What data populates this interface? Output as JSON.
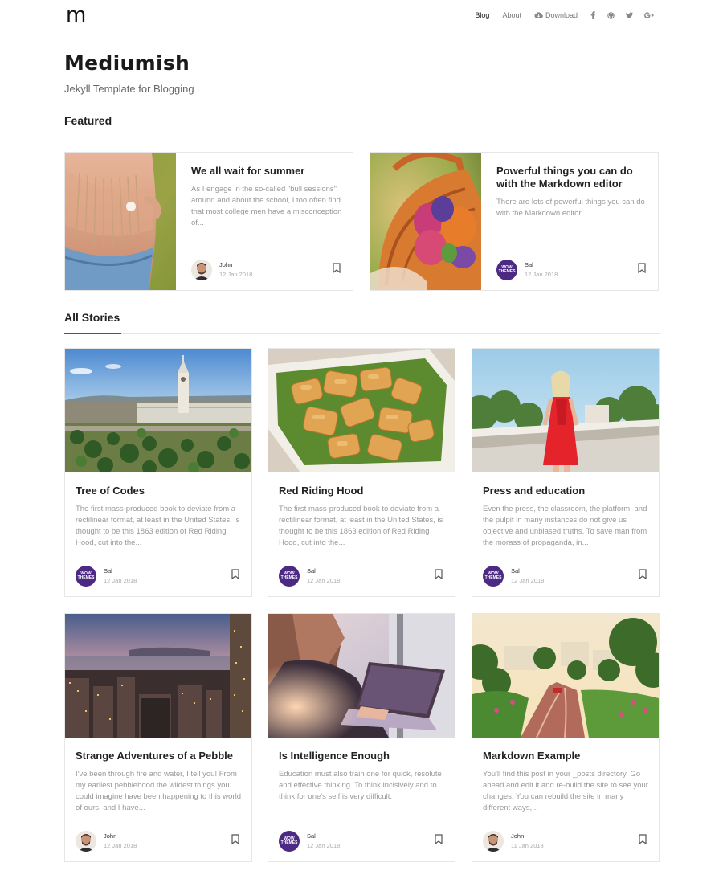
{
  "nav": {
    "logo": "m",
    "items": [
      {
        "label": "Blog",
        "active": true
      },
      {
        "label": "About",
        "active": false
      },
      {
        "label": "Download",
        "active": false,
        "icon": "cloud-download-icon"
      }
    ],
    "social": [
      "facebook-icon",
      "github-icon",
      "twitter-icon",
      "google-plus-icon"
    ]
  },
  "site": {
    "title": "Mediumish",
    "description": "Jekyll Template for Blogging"
  },
  "sections": {
    "featured": "Featured",
    "all_stories": "All Stories"
  },
  "featured": [
    {
      "title": "We all wait for summer",
      "excerpt": "As I engage in the so-called \"bull sessions\" around and about the school, I too often find that most college men have a misconception of...",
      "author": "John",
      "date": "12 Jan 2018"
    },
    {
      "title": "Powerful things you can do with the Markdown editor",
      "excerpt": "There are lots of powerful things you can do with the Markdown editor",
      "author": "Sal",
      "date": "12 Jan 2018"
    }
  ],
  "stories": [
    {
      "title": "Tree of Codes",
      "excerpt": "The first mass-produced book to deviate from a rectilinear format, at least in the United States, is thought to be this 1863 edition of Red Riding Hood, cut into the...",
      "author": "Sal",
      "date": "12 Jan 2018"
    },
    {
      "title": "Red Riding Hood",
      "excerpt": "The first mass-produced book to deviate from a rectilinear format, at least in the United States, is thought to be this 1863 edition of Red Riding Hood, cut into the...",
      "author": "Sal",
      "date": "12 Jan 2018"
    },
    {
      "title": "Press and education",
      "excerpt": "Even the press, the classroom, the platform, and the pulpit in many instances do not give us objective and unbiased truths. To save man from the morass of propaganda, in...",
      "author": "Sal",
      "date": "12 Jan 2018"
    },
    {
      "title": "Strange Adventures of a Pebble",
      "excerpt": "I've been through fire and water, I tell you! From my earliest pebblehood the wildest things you could imagine have been happening to this world of ours, and I have...",
      "author": "John",
      "date": "12 Jan 2018"
    },
    {
      "title": "Is Intelligence Enough",
      "excerpt": "Education must also train one for quick, resolute and effective thinking. To think incisively and to think for one's self is very difficult.",
      "author": "Sal",
      "date": "12 Jan 2018"
    },
    {
      "title": "Markdown Example",
      "excerpt": "You'll find this post in your _posts directory. Go ahead and edit it and re-build the site to see your changes. You can rebuild the site in many different ways,...",
      "author": "John",
      "date": "11 Jan 2018"
    }
  ],
  "avatar_badge": {
    "line1": "WOW",
    "line2": "THEMES"
  }
}
